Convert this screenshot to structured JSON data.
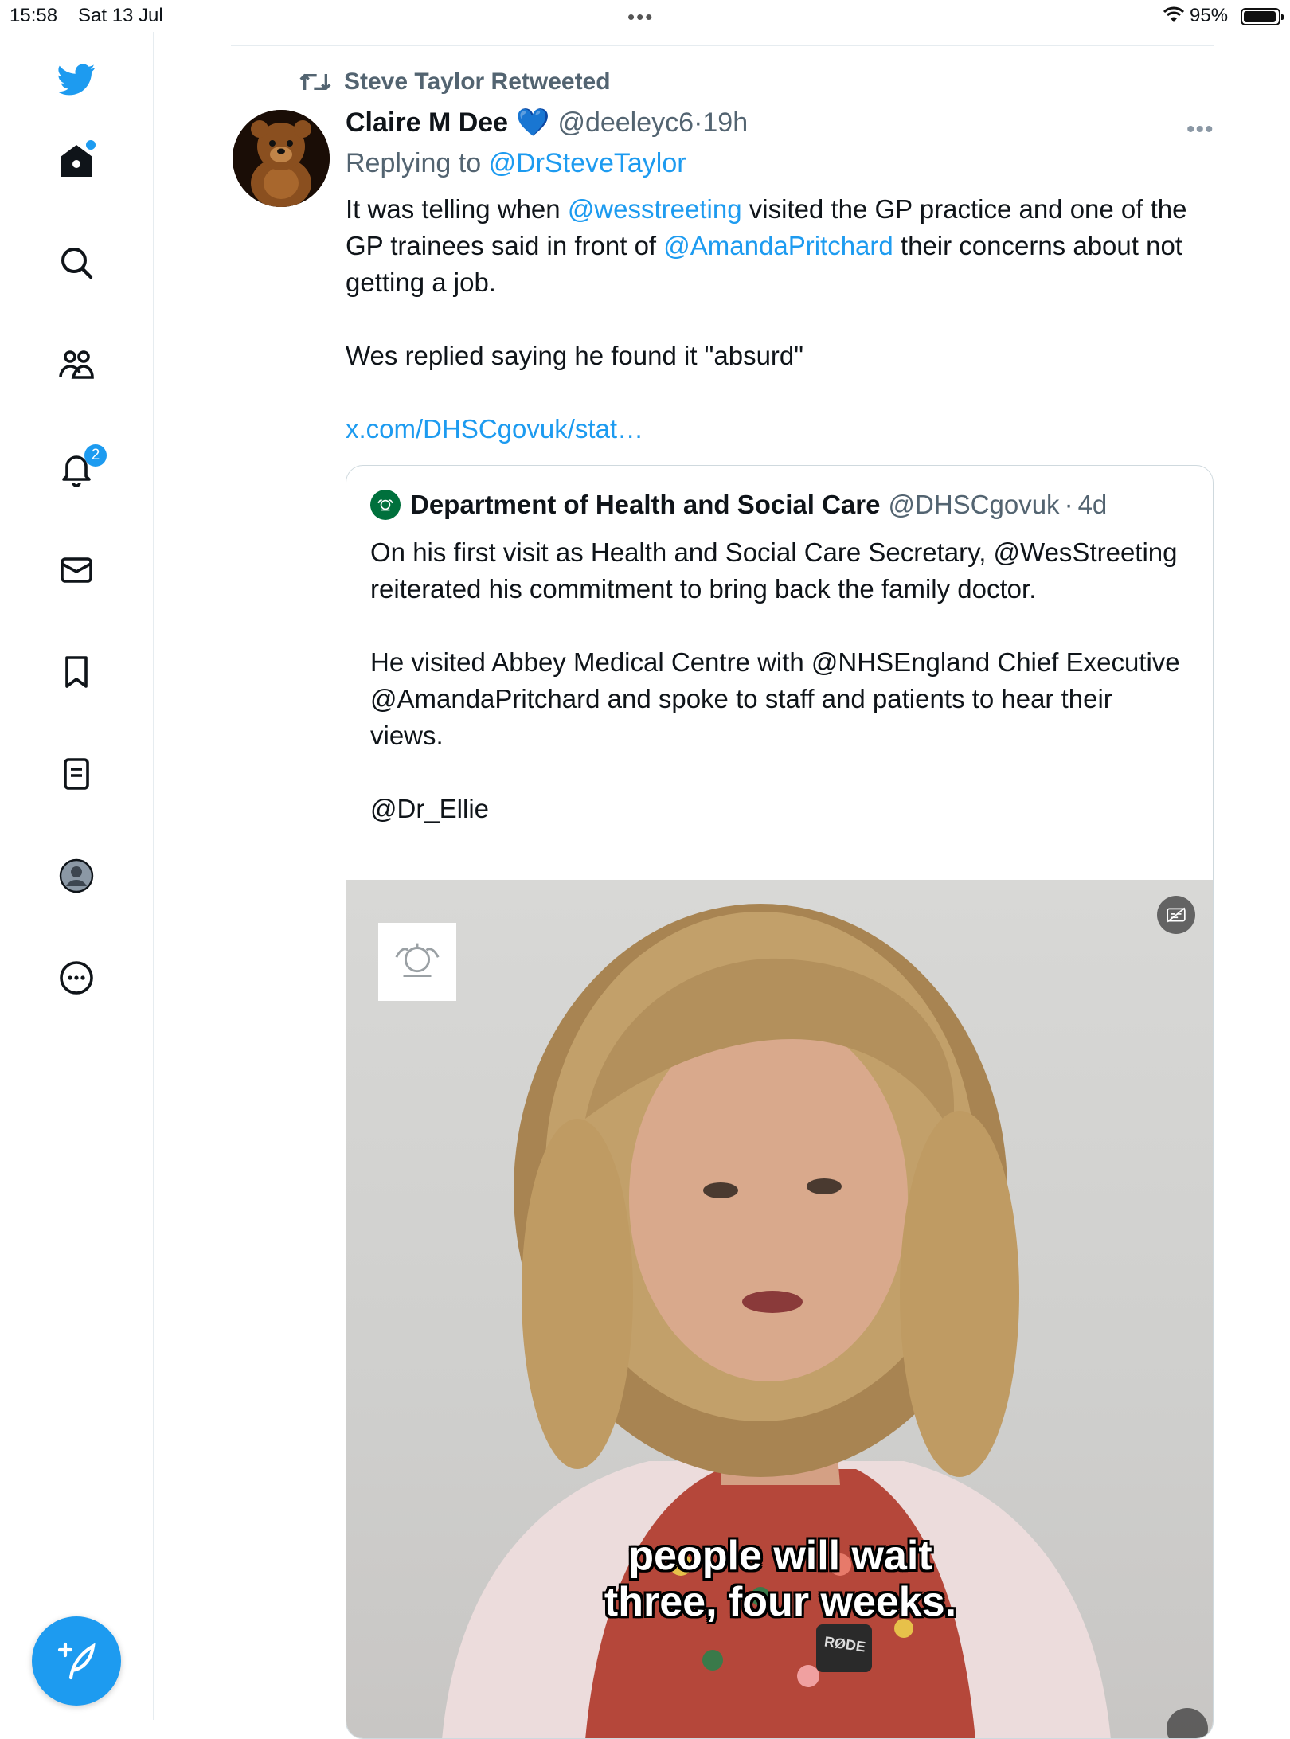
{
  "status_bar": {
    "time": "15:58",
    "date": "Sat 13 Jul",
    "battery": "95%"
  },
  "sidebar": {
    "items": [
      {
        "name": "twitter-logo"
      },
      {
        "name": "home"
      },
      {
        "name": "explore"
      },
      {
        "name": "communities"
      },
      {
        "name": "notifications",
        "badge": "2"
      },
      {
        "name": "messages"
      },
      {
        "name": "bookmarks"
      },
      {
        "name": "lists"
      },
      {
        "name": "profile"
      },
      {
        "name": "more"
      }
    ],
    "notification_badge": "2"
  },
  "tweet": {
    "retweeted_by": "Steve Taylor Retweeted",
    "author_name": "Claire M Dee",
    "author_emoji": "💙",
    "author_handle": "@deeleyc6",
    "separator": "·",
    "time": "19h",
    "replying_label": "Replying to",
    "replying_to": "@DrSteveTaylor",
    "text": {
      "p1_a": "It was telling when ",
      "p1_link1": "@wesstreeting",
      "p1_b": " visited the GP practice and one of the GP trainees said in front of ",
      "p1_link2": "@AmandaPritchard",
      "p1_c": " their concerns about not getting a job.",
      "p2": "Wes replied saying he found it \"absurd\"",
      "url": "x.com/DHSCgovuk/stat…"
    }
  },
  "quote": {
    "name": "Department of Health and Social Care",
    "handle": "@DHSCgovuk",
    "separator": "·",
    "time": "4d",
    "p1": "On his first visit as Health and Social Care Secretary, @WesStreeting reiterated his commitment to bring back the family doctor.",
    "p2": "He visited Abbey Medical Centre with @NHSEngland Chief Executive @AmandaPritchard and spoke to staff and patients to hear their views.",
    "p3": "@Dr_Ellie",
    "video": {
      "subtitle_line1": "people will wait",
      "subtitle_line2": "three, four weeks.",
      "mic_brand": "RØDE"
    }
  },
  "colors": {
    "accent": "#1d9bf0",
    "text": "#0f1419",
    "muted": "#536471"
  }
}
